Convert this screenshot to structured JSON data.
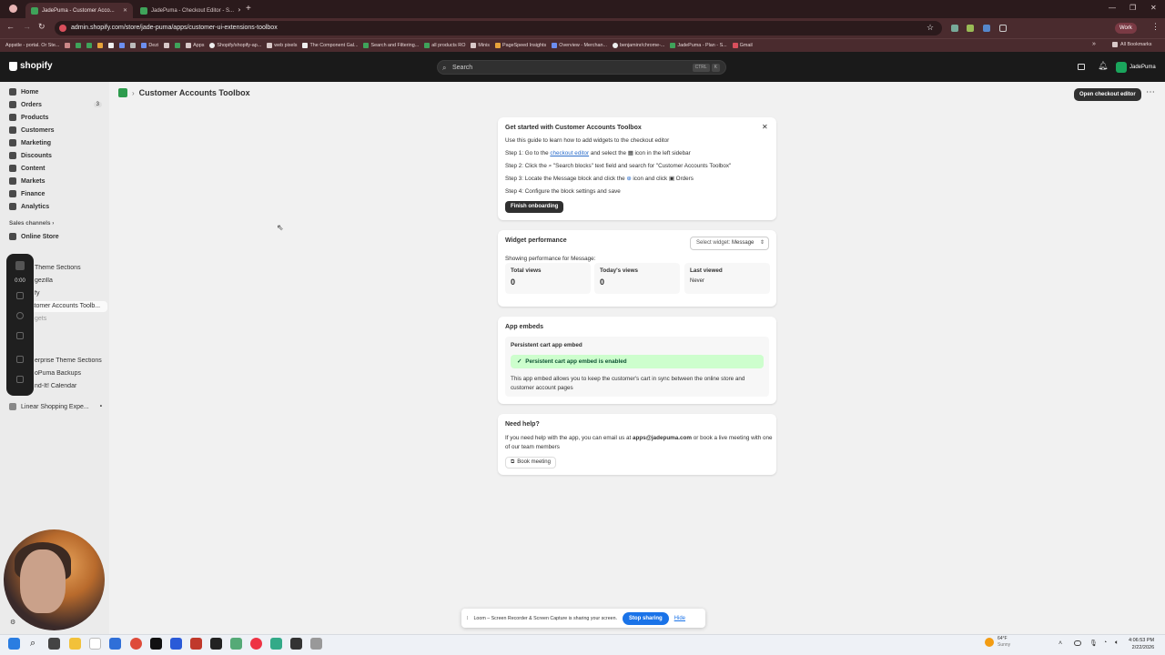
{
  "browser": {
    "tabs": [
      {
        "title": "JadePuma - Customer Acco...",
        "active": true
      },
      {
        "title": "JadePuma - Checkout Editor - S...",
        "active": false
      }
    ],
    "url": "admin.shopify.com/store/jade-puma/apps/customer-ui-extensions-toolbox",
    "profile": "Work",
    "bookmarks": [
      "Appstle - portal. Or Ste...",
      "Dezi",
      "Apps",
      "Shopify/shopify-ap...",
      "web pixels",
      "The Component Gal...",
      "Search and Filtering...",
      "all products RO",
      "Minis",
      "PageSpeed Insights",
      "Overview - Merchan...",
      "benjaminr/chrome-...",
      "JadePuma - Plan - S...",
      "Gmail"
    ],
    "all_bookmarks": "All Bookmarks"
  },
  "topbar": {
    "logo": "shopify",
    "search_placeholder": "Search",
    "kb_ctrl": "CTRL",
    "kb_k": "K",
    "store_name": "JadePuma"
  },
  "sidebar": {
    "items": [
      {
        "label": "Home",
        "icon": "home-icon"
      },
      {
        "label": "Orders",
        "icon": "orders-icon",
        "badge": "3"
      },
      {
        "label": "Products",
        "icon": "tag-icon"
      },
      {
        "label": "Customers",
        "icon": "person-icon"
      },
      {
        "label": "Marketing",
        "icon": "target-icon"
      },
      {
        "label": "Discounts",
        "icon": "discount-icon"
      },
      {
        "label": "Content",
        "icon": "content-icon"
      },
      {
        "label": "Markets",
        "icon": "globe-icon"
      },
      {
        "label": "Finance",
        "icon": "bank-icon"
      },
      {
        "label": "Analytics",
        "icon": "chart-icon"
      }
    ],
    "sales_channels": "Sales channels",
    "online_store": "Online Store",
    "apps": [
      "Theme Sections",
      "gezilla",
      "fy",
      "stomer Accounts Toolb...",
      "gets",
      "erprise Theme Sections",
      "oPuma Backups",
      "nd-It! Calendar"
    ],
    "linear": "Linear Shopping Expe...",
    "loom_timer": "0:00"
  },
  "page": {
    "title": "Customer Accounts Toolbox",
    "open_checkout_editor": "Open checkout editor"
  },
  "onboarding": {
    "title": "Get started with Customer Accounts Toolbox",
    "intro": "Use this guide to learn how to add widgets to the checkout editor",
    "step1_a": "Step 1: Go to the",
    "step1_link": "checkout editor",
    "step1_b": "and select the",
    "step1_c": "icon in the left sidebar",
    "step2_a": "Step 2: Click the",
    "step2_b": "\"Search blocks\" text field and search for \"Customer Accounts Toolbox\"",
    "step3_a": "Step 3: Locate the Message block and click the",
    "step3_b": "icon and click",
    "step3_c": "Orders",
    "step4": "Step 4: Configure the block settings and save",
    "button": "Finish onboarding"
  },
  "widget_performance": {
    "title": "Widget performance",
    "select_label": "Select widget:",
    "select_value": "Message",
    "showing": "Showing performance for Message:",
    "stats": [
      {
        "label": "Total views",
        "value": "0"
      },
      {
        "label": "Today's views",
        "value": "0"
      },
      {
        "label": "Last viewed",
        "value": "Never"
      }
    ]
  },
  "app_embeds": {
    "title": "App embeds",
    "subtitle": "Persistent cart app embed",
    "status": "Persistent cart app embed is enabled",
    "status_color": "#cdfecd",
    "description": "This app embed allows you to keep the customer's cart in sync between the online store and customer account pages"
  },
  "help": {
    "title": "Need help?",
    "text_a": "If you need help with the app, you can email us at",
    "email": "apps@jadepuma.com",
    "text_b": "or book a live meeting with one of our team members",
    "button": "Book meeting"
  },
  "loom": {
    "message": "Loom – Screen Recorder & Screen Capture is sharing your screen.",
    "stop": "Stop sharing",
    "hide": "Hide"
  },
  "taskbar": {
    "weather_temp": "64°F",
    "weather_desc": "Sunny",
    "time": "4:06:53 PM",
    "date": "2/22/2026"
  }
}
